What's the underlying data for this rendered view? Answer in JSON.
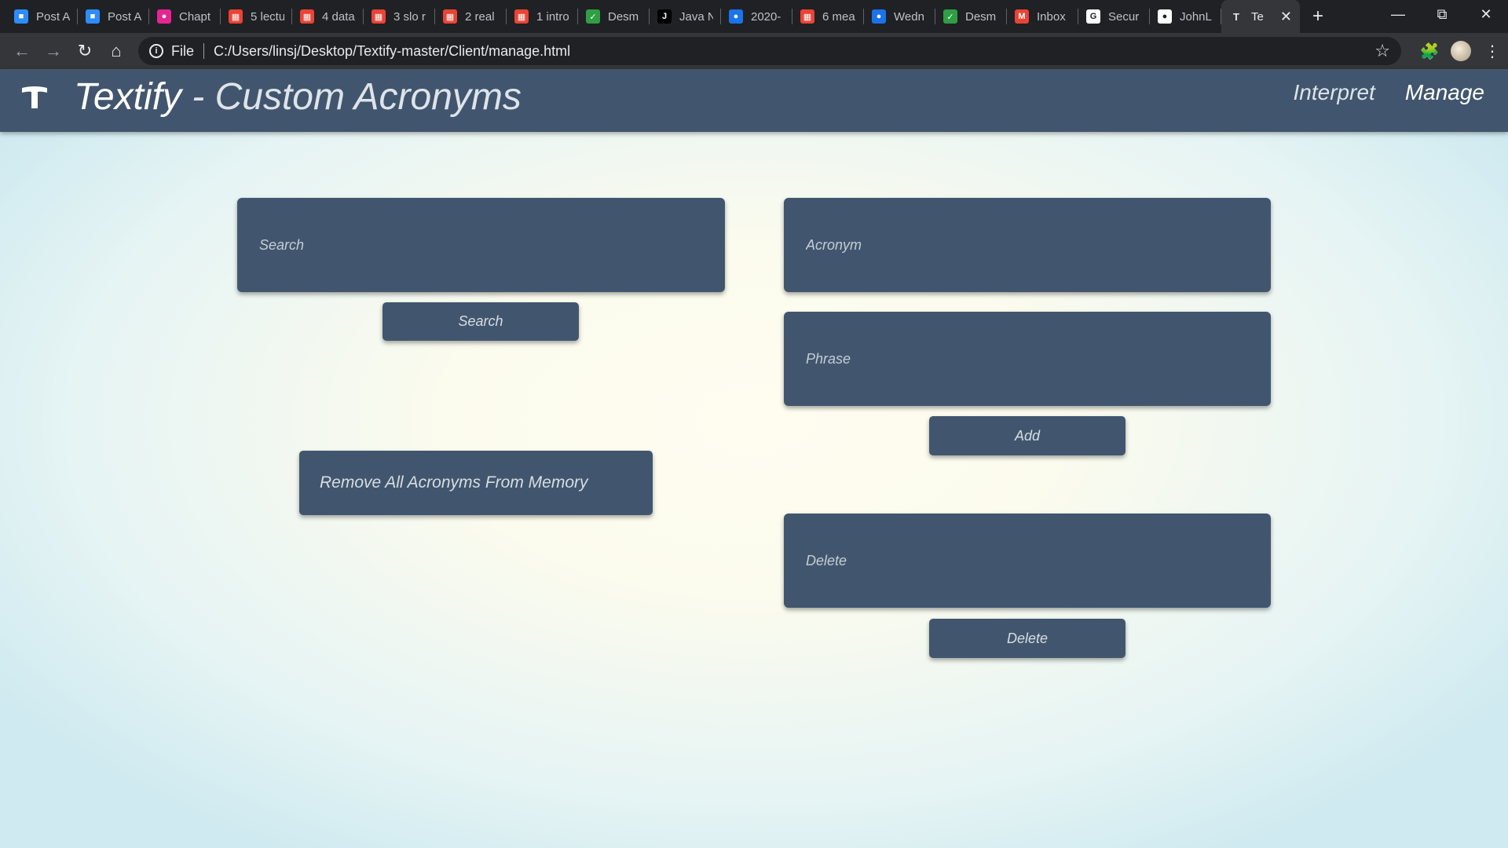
{
  "browser": {
    "tabs": [
      {
        "title": "Post A",
        "icon": "zoom-icon",
        "color": "#2d8cff"
      },
      {
        "title": "Post A",
        "icon": "zoom-icon",
        "color": "#2d8cff"
      },
      {
        "title": "Chapt",
        "icon": "classroom-icon",
        "color": "#e52592"
      },
      {
        "title": "5 lectu",
        "icon": "calendar-icon",
        "color": "#ea4335"
      },
      {
        "title": "4 data",
        "icon": "calendar-icon",
        "color": "#ea4335"
      },
      {
        "title": "3 slo r",
        "icon": "calendar-icon",
        "color": "#ea4335"
      },
      {
        "title": "2 real",
        "icon": "calendar-icon",
        "color": "#ea4335"
      },
      {
        "title": "1 intro",
        "icon": "calendar-icon",
        "color": "#ea4335"
      },
      {
        "title": "Desm",
        "icon": "desmos-icon",
        "color": "#2f9e44"
      },
      {
        "title": "Java N",
        "icon": "j-icon",
        "color": "#000000"
      },
      {
        "title": "2020-",
        "icon": "classroom-icon",
        "color": "#1a73e8"
      },
      {
        "title": "6 mea",
        "icon": "calendar-icon",
        "color": "#ea4335"
      },
      {
        "title": "Wedn",
        "icon": "classroom-icon",
        "color": "#1a73e8"
      },
      {
        "title": "Desm",
        "icon": "desmos-icon",
        "color": "#2f9e44"
      },
      {
        "title": "Inbox",
        "icon": "gmail-icon",
        "color": "#ea4335"
      },
      {
        "title": "Secur",
        "icon": "google-icon",
        "color": "#ffffff"
      },
      {
        "title": "JohnL",
        "icon": "github-icon",
        "color": "#ffffff"
      }
    ],
    "active_tab": {
      "title": "Te",
      "icon": "textify-icon"
    },
    "url_scheme": "File",
    "url": "C:/Users/linsj/Desktop/Textify-master/Client/manage.html"
  },
  "app": {
    "brand": "Textify",
    "subtitle": " - Custom Acronyms",
    "nav": {
      "interpret": "Interpret",
      "manage": "Manage"
    },
    "colors": {
      "header": "#41566e",
      "panel": "#41566e",
      "text": "#ffffff"
    }
  },
  "form": {
    "search_placeholder": "Search",
    "search_button": "Search",
    "remove_all_button": "Remove All Acronyms From Memory",
    "acronym_placeholder": "Acronym",
    "phrase_placeholder": "Phrase",
    "add_button": "Add",
    "delete_placeholder": "Delete",
    "delete_button": "Delete"
  }
}
